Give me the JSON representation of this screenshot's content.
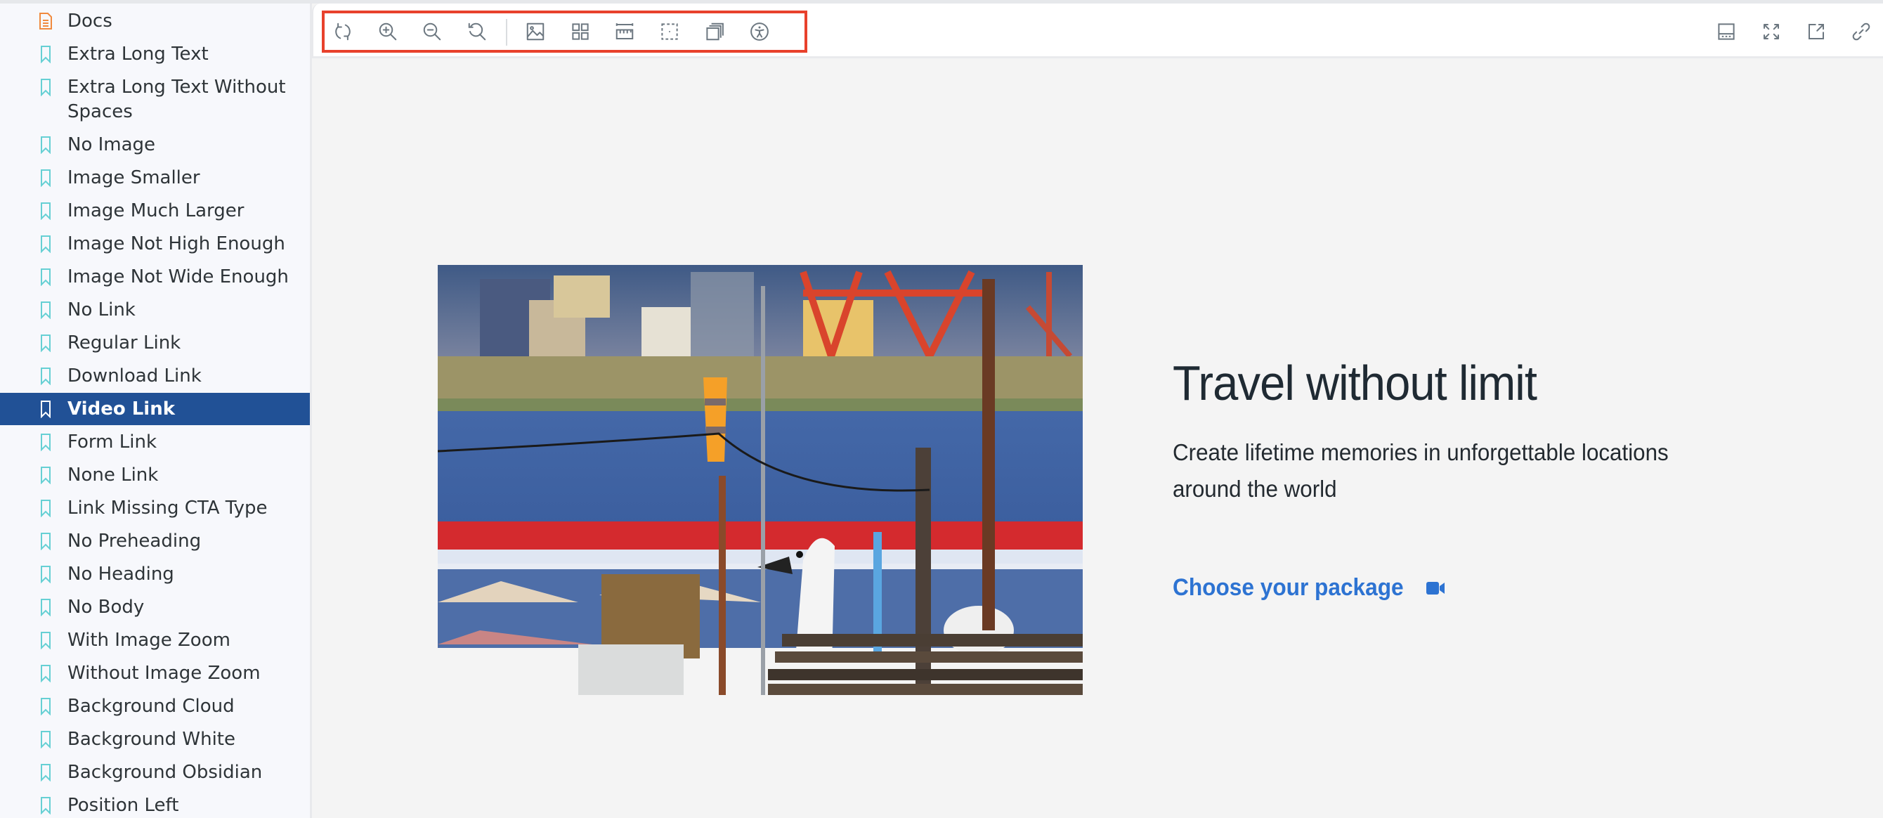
{
  "sidebar": {
    "items": [
      {
        "label": "Docs",
        "icon": "document-icon",
        "active": false
      },
      {
        "label": "Extra Long Text",
        "icon": "bookmark-icon",
        "active": false
      },
      {
        "label": "Extra Long Text Without Spaces",
        "icon": "bookmark-icon",
        "active": false
      },
      {
        "label": "No Image",
        "icon": "bookmark-icon",
        "active": false
      },
      {
        "label": "Image Smaller",
        "icon": "bookmark-icon",
        "active": false
      },
      {
        "label": "Image Much Larger",
        "icon": "bookmark-icon",
        "active": false
      },
      {
        "label": "Image Not High Enough",
        "icon": "bookmark-icon",
        "active": false
      },
      {
        "label": "Image Not Wide Enough",
        "icon": "bookmark-icon",
        "active": false
      },
      {
        "label": "No Link",
        "icon": "bookmark-icon",
        "active": false
      },
      {
        "label": "Regular Link",
        "icon": "bookmark-icon",
        "active": false
      },
      {
        "label": "Download Link",
        "icon": "bookmark-icon",
        "active": false
      },
      {
        "label": "Video Link",
        "icon": "bookmark-icon",
        "active": true
      },
      {
        "label": "Form Link",
        "icon": "bookmark-icon",
        "active": false
      },
      {
        "label": "None Link",
        "icon": "bookmark-icon",
        "active": false
      },
      {
        "label": "Link Missing CTA Type",
        "icon": "bookmark-icon",
        "active": false
      },
      {
        "label": "No Preheading",
        "icon": "bookmark-icon",
        "active": false
      },
      {
        "label": "No Heading",
        "icon": "bookmark-icon",
        "active": false
      },
      {
        "label": "No Body",
        "icon": "bookmark-icon",
        "active": false
      },
      {
        "label": "With Image Zoom",
        "icon": "bookmark-icon",
        "active": false
      },
      {
        "label": "Without Image Zoom",
        "icon": "bookmark-icon",
        "active": false
      },
      {
        "label": "Background Cloud",
        "icon": "bookmark-icon",
        "active": false
      },
      {
        "label": "Background White",
        "icon": "bookmark-icon",
        "active": false
      },
      {
        "label": "Background Obsidian",
        "icon": "bookmark-icon",
        "active": false
      },
      {
        "label": "Position Left",
        "icon": "bookmark-icon",
        "active": false
      }
    ]
  },
  "toolbar": {
    "left_tools": [
      "reload-icon",
      "zoom-in-icon",
      "zoom-out-icon",
      "reset-zoom-icon"
    ],
    "right_tools": [
      "background-image-icon",
      "grid-icon",
      "measure-ruler-icon",
      "outline-icon",
      "viewport-icon",
      "accessibility-icon"
    ],
    "addon_tools": [
      "addons-panel-icon",
      "fullscreen-icon",
      "open-new-tab-icon",
      "copy-link-icon"
    ]
  },
  "preview": {
    "heading": "Travel without limit",
    "body": "Create lifetime memories in unforgettable locations around the world",
    "cta_label": "Choose your package",
    "cta_icon": "video-camera-icon"
  },
  "colors": {
    "active_item_bg": "#215196",
    "bookmark_icon": "#66d0d4",
    "docs_icon": "#f08a3e",
    "cta": "#2d73d2",
    "highlight_border": "#e8412c"
  }
}
